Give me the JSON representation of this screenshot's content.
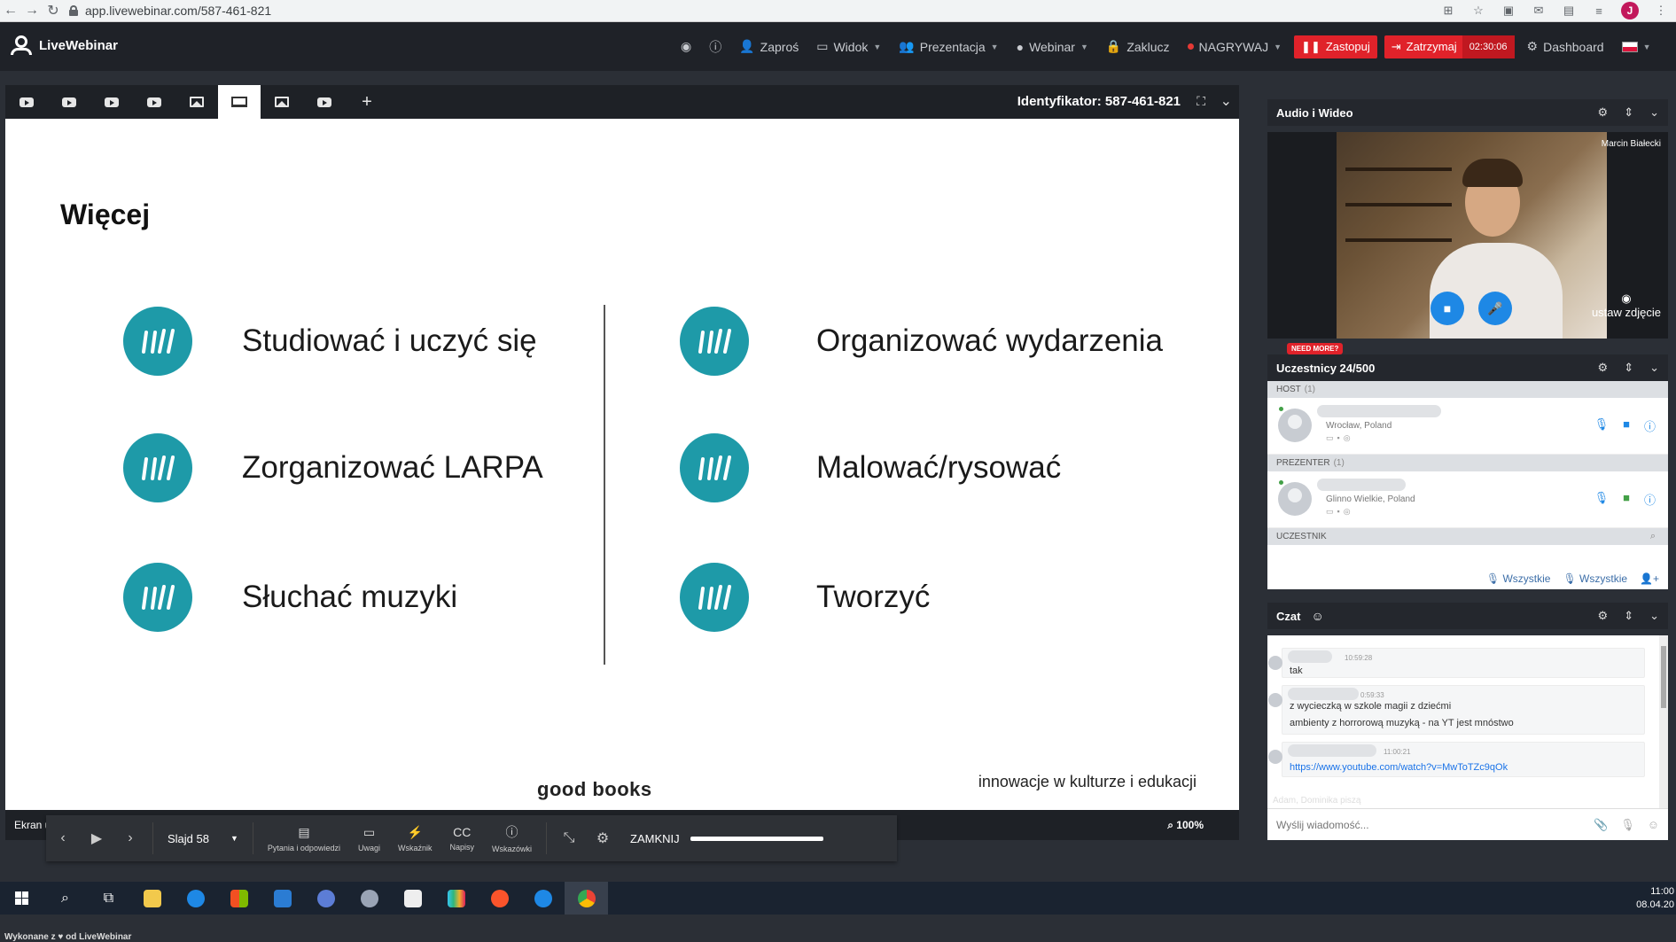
{
  "browser": {
    "url": "app.livewebinar.com/587-461-821"
  },
  "header": {
    "logo": "LiveWebinar",
    "menu": [
      {
        "label": "Zaproś"
      },
      {
        "label": "Widok"
      },
      {
        "label": "Prezentacja"
      },
      {
        "label": "Webinar"
      },
      {
        "label": "Zaklucz"
      },
      {
        "label": "NAGRYWAJ"
      }
    ],
    "replace_label": "Zastopuj",
    "stop_label": "Zatrzymaj",
    "timer": "02:30:06",
    "dashboard_label": "Dashboard"
  },
  "presentation": {
    "identifier": "Identyfikator: 587-461-821",
    "slide": {
      "title": "Więcej",
      "left_items": [
        "Studiować i uczyć się",
        "Zorganizować LARPA",
        "Słuchać muzyki"
      ],
      "right_items": [
        "Organizować wydarzenia",
        "Malować/rysować",
        "Tworzyć"
      ],
      "footer_brand": "good books",
      "footer_tagline": "innowacje w kulturze i edukacji"
    },
    "controls": {
      "slide_label": "Slajd 58",
      "qa_label": "Pytania i odpowiedzi",
      "notes_label": "Uwagi",
      "pointer_label": "Wskaźnik",
      "captions_label": "Napisy",
      "hints_label": "Wskazówki",
      "close_label": "ZAMKNIJ"
    },
    "shared_by": "Ekran udostępniany przez Marcin Białecki",
    "zoom": "100%"
  },
  "made_with": "Wykonane z ♥ od LiveWebinar",
  "audio_video": {
    "title": "Audio i Wideo",
    "presenter": "Marcin Białecki",
    "set_photo": "ustaw zdjęcie"
  },
  "participants": {
    "need_more": "NEED MORE?",
    "title": "Uczestnicy 24/500",
    "groups": [
      {
        "name": "HOST",
        "count": "(1)",
        "location": "Wrocław, Poland"
      },
      {
        "name": "PREZENTER",
        "count": "(1)",
        "location": "Glinno Wielkie, Poland"
      }
    ],
    "attendee_group": "UCZESTNIK",
    "all_mic": "Wszystkie",
    "all_hand": "Wszystkie"
  },
  "chat": {
    "title": "Czat",
    "messages": [
      {
        "time": "10:59:28",
        "text": "tak"
      },
      {
        "time": "0:59:33",
        "text": "z wycieczką w szkole magii z dziećmi",
        "text2": "ambienty z horrorową muzyką - na YT jest mnóstwo"
      },
      {
        "time": "11:00:21",
        "text": "https://www.youtube.com/watch?v=MwToTZc9qOk"
      }
    ],
    "typing": "Adam, Dominika piszą",
    "input_placeholder": "Wyślij wiadomość..."
  },
  "taskbar": {
    "time": "11:00",
    "date": "08.04.20"
  },
  "colors": {
    "accent_teal": "#1e9aa8",
    "record_red": "#e0222a",
    "link_blue": "#1a73e8"
  }
}
